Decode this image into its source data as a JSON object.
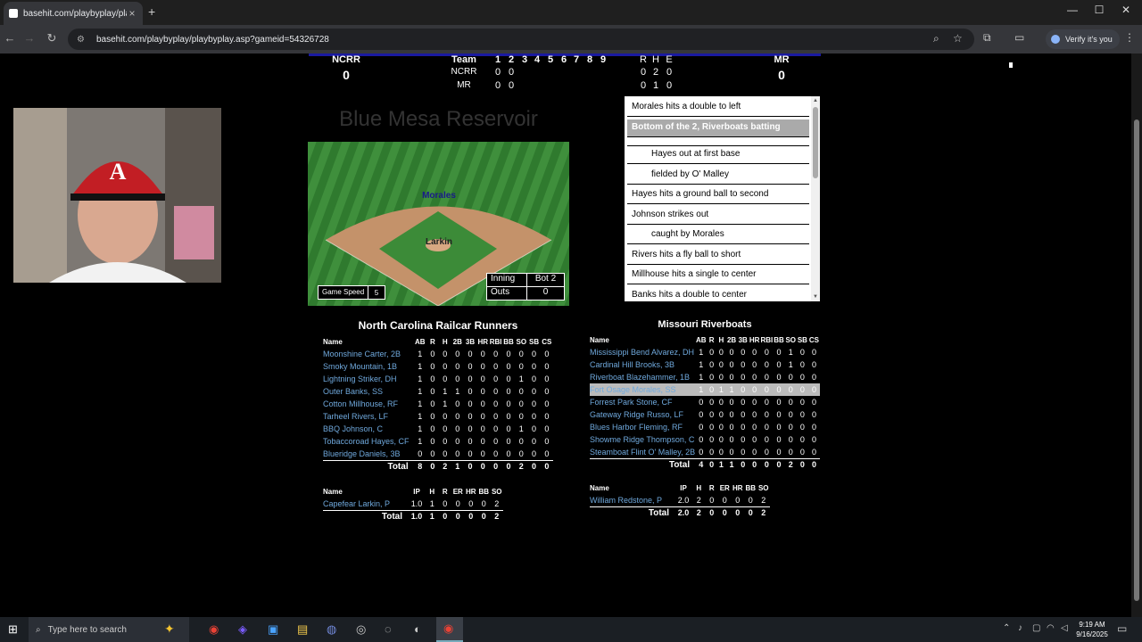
{
  "browser": {
    "tab_title": "basehit.com/playbyplay/playby",
    "url": "basehit.com/playbyplay/playbyplay.asp?gameid=54326728",
    "verify_label": "Verify it's you"
  },
  "scoreboard": {
    "away_abbr": "NCRR",
    "away_score": "0",
    "home_abbr": "MR",
    "home_score": "0",
    "team_header": "Team",
    "innings": [
      "1",
      "2",
      "3",
      "4",
      "5",
      "6",
      "7",
      "8",
      "9"
    ],
    "rhe_header": [
      "R",
      "H",
      "E"
    ],
    "rows": [
      {
        "team": "NCRR",
        "line": [
          "0",
          "0"
        ],
        "rhe": [
          "0",
          "2",
          "0"
        ]
      },
      {
        "team": "MR",
        "line": [
          "0",
          "0"
        ],
        "rhe": [
          "0",
          "1",
          "0"
        ]
      }
    ]
  },
  "stadium": {
    "name": "Blue Mesa Reservoir",
    "fielder_label": "Morales",
    "pitcher_label": "Larkin",
    "game_speed_label": "Game Speed",
    "game_speed_value": "5",
    "inning_label": "Inning",
    "inning_value": "Bot 2",
    "outs_label": "Outs",
    "outs_value": "0"
  },
  "play_by_play": [
    {
      "text": "Morales hits a double to left",
      "indent": false,
      "highlight": false
    },
    {
      "text": "Bottom of the 2, Riverboats batting",
      "indent": false,
      "highlight": true
    },
    {
      "text": "",
      "indent": false,
      "highlight": false
    },
    {
      "text": "Hayes out at first base",
      "indent": true,
      "highlight": false
    },
    {
      "text": "fielded by O' Malley",
      "indent": true,
      "highlight": false
    },
    {
      "text": "Hayes hits a ground ball to second",
      "indent": false,
      "highlight": false
    },
    {
      "text": "Johnson strikes out",
      "indent": false,
      "highlight": false
    },
    {
      "text": "caught by Morales",
      "indent": true,
      "highlight": false
    },
    {
      "text": "Rivers hits a fly ball to short",
      "indent": false,
      "highlight": false
    },
    {
      "text": "Millhouse hits a single to center",
      "indent": false,
      "highlight": false
    },
    {
      "text": "Banks hits a double to center",
      "indent": false,
      "highlight": false
    }
  ],
  "away_box": {
    "team_name": "North Carolina Railcar Runners",
    "batting_headers": [
      "Name",
      "AB",
      "R",
      "H",
      "2B",
      "3B",
      "HR",
      "RBI",
      "BB",
      "SO",
      "SB",
      "CS"
    ],
    "batters": [
      {
        "name": "Moonshine Carter, 2B",
        "stats": [
          "1",
          "0",
          "0",
          "0",
          "0",
          "0",
          "0",
          "0",
          "0",
          "0",
          "0"
        ]
      },
      {
        "name": "Smoky Mountain, 1B",
        "stats": [
          "1",
          "0",
          "0",
          "0",
          "0",
          "0",
          "0",
          "0",
          "0",
          "0",
          "0"
        ]
      },
      {
        "name": "Lightning Striker, DH",
        "stats": [
          "1",
          "0",
          "0",
          "0",
          "0",
          "0",
          "0",
          "0",
          "1",
          "0",
          "0"
        ]
      },
      {
        "name": "Outer Banks, SS",
        "stats": [
          "1",
          "0",
          "1",
          "1",
          "0",
          "0",
          "0",
          "0",
          "0",
          "0",
          "0"
        ]
      },
      {
        "name": "Cotton Millhouse, RF",
        "stats": [
          "1",
          "0",
          "1",
          "0",
          "0",
          "0",
          "0",
          "0",
          "0",
          "0",
          "0"
        ]
      },
      {
        "name": "Tarheel Rivers, LF",
        "stats": [
          "1",
          "0",
          "0",
          "0",
          "0",
          "0",
          "0",
          "0",
          "0",
          "0",
          "0"
        ]
      },
      {
        "name": "BBQ Johnson, C",
        "stats": [
          "1",
          "0",
          "0",
          "0",
          "0",
          "0",
          "0",
          "0",
          "1",
          "0",
          "0"
        ]
      },
      {
        "name": "Tobaccoroad Hayes, CF",
        "stats": [
          "1",
          "0",
          "0",
          "0",
          "0",
          "0",
          "0",
          "0",
          "0",
          "0",
          "0"
        ]
      },
      {
        "name": "Blueridge Daniels, 3B",
        "stats": [
          "0",
          "0",
          "0",
          "0",
          "0",
          "0",
          "0",
          "0",
          "0",
          "0",
          "0"
        ]
      }
    ],
    "batting_total_label": "Total",
    "batting_total": [
      "8",
      "0",
      "2",
      "1",
      "0",
      "0",
      "0",
      "0",
      "2",
      "0",
      "0"
    ],
    "pitching_headers": [
      "Name",
      "IP",
      "H",
      "R",
      "ER",
      "HR",
      "BB",
      "SO"
    ],
    "pitchers": [
      {
        "name": "Capefear Larkin, P",
        "stats": [
          "1.0",
          "1",
          "0",
          "0",
          "0",
          "0",
          "2"
        ]
      }
    ],
    "pitching_total_label": "Total",
    "pitching_total": [
      "1.0",
      "1",
      "0",
      "0",
      "0",
      "0",
      "2"
    ]
  },
  "home_box": {
    "team_name": "Missouri Riverboats",
    "batting_headers": [
      "Name",
      "AB",
      "R",
      "H",
      "2B",
      "3B",
      "HR",
      "RBI",
      "BB",
      "SO",
      "SB",
      "CS"
    ],
    "batters": [
      {
        "name": "Mississippi Bend Alvarez, DH",
        "stats": [
          "1",
          "0",
          "0",
          "0",
          "0",
          "0",
          "0",
          "0",
          "1",
          "0",
          "0"
        ],
        "selected": false
      },
      {
        "name": "Cardinal Hill Brooks, 3B",
        "stats": [
          "1",
          "0",
          "0",
          "0",
          "0",
          "0",
          "0",
          "0",
          "1",
          "0",
          "0"
        ],
        "selected": false
      },
      {
        "name": "Riverboat Blazehammer, 1B",
        "stats": [
          "1",
          "0",
          "0",
          "0",
          "0",
          "0",
          "0",
          "0",
          "0",
          "0",
          "0"
        ],
        "selected": false
      },
      {
        "name": "Fort Osage Morales, SS",
        "stats": [
          "1",
          "0",
          "1",
          "1",
          "0",
          "0",
          "0",
          "0",
          "0",
          "0",
          "0"
        ],
        "selected": true
      },
      {
        "name": "Forrest Park Stone, CF",
        "stats": [
          "0",
          "0",
          "0",
          "0",
          "0",
          "0",
          "0",
          "0",
          "0",
          "0",
          "0"
        ],
        "selected": false
      },
      {
        "name": "Gateway Ridge Russo, LF",
        "stats": [
          "0",
          "0",
          "0",
          "0",
          "0",
          "0",
          "0",
          "0",
          "0",
          "0",
          "0"
        ],
        "selected": false
      },
      {
        "name": "Blues Harbor Fleming, RF",
        "stats": [
          "0",
          "0",
          "0",
          "0",
          "0",
          "0",
          "0",
          "0",
          "0",
          "0",
          "0"
        ],
        "selected": false
      },
      {
        "name": "Showme Ridge Thompson, C",
        "stats": [
          "0",
          "0",
          "0",
          "0",
          "0",
          "0",
          "0",
          "0",
          "0",
          "0",
          "0"
        ],
        "selected": false
      },
      {
        "name": "Steamboat Flint O' Malley, 2B",
        "stats": [
          "0",
          "0",
          "0",
          "0",
          "0",
          "0",
          "0",
          "0",
          "0",
          "0",
          "0"
        ],
        "selected": false
      }
    ],
    "batting_total_label": "Total",
    "batting_total": [
      "4",
      "0",
      "1",
      "1",
      "0",
      "0",
      "0",
      "0",
      "2",
      "0",
      "0"
    ],
    "pitching_headers": [
      "Name",
      "IP",
      "H",
      "R",
      "ER",
      "HR",
      "BB",
      "SO"
    ],
    "pitchers": [
      {
        "name": "William Redstone, P",
        "stats": [
          "2.0",
          "2",
          "0",
          "0",
          "0",
          "0",
          "2"
        ]
      }
    ],
    "pitching_total_label": "Total",
    "pitching_total": [
      "2.0",
      "2",
      "0",
      "0",
      "0",
      "0",
      "2"
    ]
  },
  "taskbar": {
    "search_placeholder": "Type here to search",
    "time": "9:19 AM",
    "date": "9/16/2025"
  }
}
